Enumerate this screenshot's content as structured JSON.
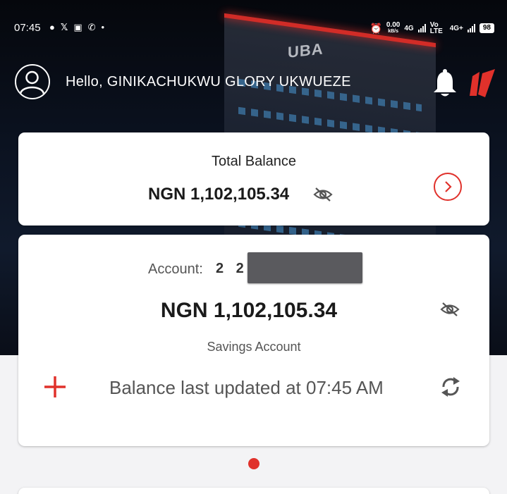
{
  "status_bar": {
    "time": "07:45",
    "net_speed": "0.00",
    "net_speed_unit": "kB/s",
    "network_1": "4G",
    "volte": "Vo LTE",
    "network_2": "4G+",
    "battery": "98"
  },
  "header": {
    "greeting": "Hello, GINIKACHUKWU GLORY UKWUEZE",
    "building_sign": "UBA"
  },
  "total_balance": {
    "label": "Total Balance",
    "amount": "NGN 1,102,105.34"
  },
  "account": {
    "label": "Account:",
    "number_visible": "2 2 4",
    "amount": "NGN 1,102,105.34",
    "type": "Savings Account",
    "updated_text": "Balance last updated at 07:45 AM"
  },
  "colors": {
    "accent": "#e0312b",
    "hero_bg": "#0b1220",
    "page_bg": "#f3f3f5"
  },
  "carousel": {
    "active_index": 0,
    "count": 1
  }
}
